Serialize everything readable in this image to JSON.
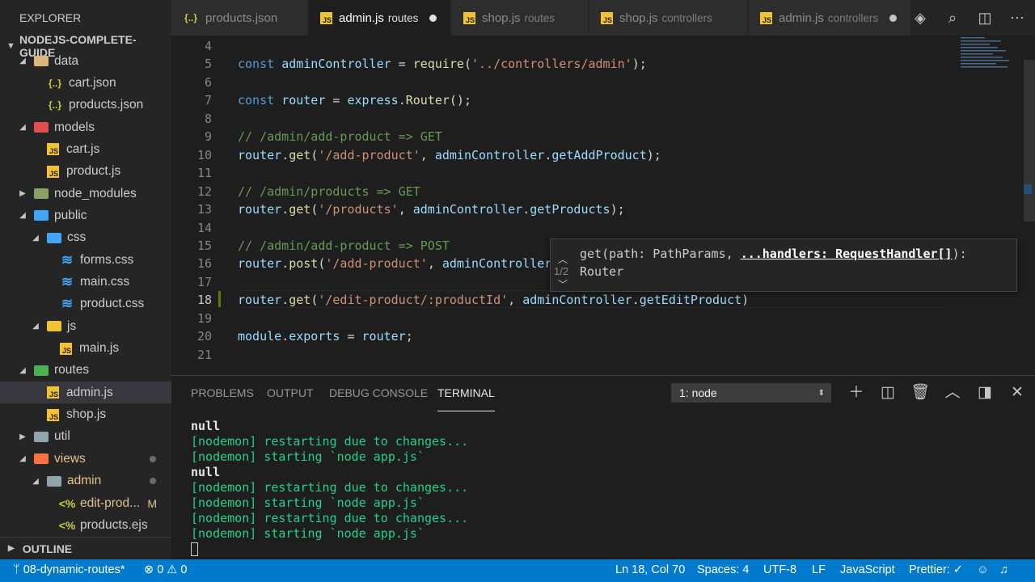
{
  "explorer": {
    "title": "EXPLORER",
    "folder": "NODEJS-COMPLETE-GUIDE",
    "tree": [
      {
        "label": "data",
        "type": "folder",
        "color": "#dcb67a",
        "open": true,
        "indent": 0
      },
      {
        "label": "cart.json",
        "type": "json",
        "indent": 1
      },
      {
        "label": "products.json",
        "type": "json",
        "indent": 1
      },
      {
        "label": "models",
        "type": "folder",
        "color": "#e04e4e",
        "open": true,
        "indent": 0
      },
      {
        "label": "cart.js",
        "type": "js",
        "indent": 1
      },
      {
        "label": "product.js",
        "type": "js",
        "indent": 1
      },
      {
        "label": "node_modules",
        "type": "folder",
        "color": "#8aa06a",
        "open": false,
        "indent": 0
      },
      {
        "label": "public",
        "type": "folder",
        "color": "#42a5f5",
        "open": true,
        "indent": 0
      },
      {
        "label": "css",
        "type": "folder",
        "color": "#42a5f5",
        "open": true,
        "indent": 1
      },
      {
        "label": "forms.css",
        "type": "css",
        "indent": 2
      },
      {
        "label": "main.css",
        "type": "css",
        "indent": 2
      },
      {
        "label": "product.css",
        "type": "css",
        "indent": 2
      },
      {
        "label": "js",
        "type": "folder",
        "color": "#f1c232",
        "open": true,
        "indent": 1
      },
      {
        "label": "main.js",
        "type": "js",
        "indent": 2
      },
      {
        "label": "routes",
        "type": "folder",
        "color": "#4caf50",
        "open": true,
        "indent": 0
      },
      {
        "label": "admin.js",
        "type": "js",
        "indent": 1,
        "selected": true
      },
      {
        "label": "shop.js",
        "type": "js",
        "indent": 1
      },
      {
        "label": "util",
        "type": "folder",
        "color": "#90a4ae",
        "open": false,
        "indent": 0
      },
      {
        "label": "views",
        "type": "folder",
        "color": "#ff7043",
        "open": true,
        "indent": 0,
        "label_color": "#e2c08d",
        "dot": true
      },
      {
        "label": "admin",
        "type": "folder",
        "color": "#90a4ae",
        "open": true,
        "indent": 1,
        "label_color": "#e2c08d",
        "dot": true
      },
      {
        "label": "edit-prod...",
        "type": "ejs",
        "indent": 2,
        "label_color": "#e2c08d",
        "mark": "M"
      },
      {
        "label": "products.ejs",
        "type": "ejs",
        "indent": 2
      }
    ],
    "outline": "OUTLINE"
  },
  "tabs": [
    {
      "name": "products.json",
      "icon": "{..}",
      "desc": "",
      "active": false,
      "dirty": false
    },
    {
      "name": "admin.js",
      "icon": "JS",
      "desc": "routes",
      "active": true,
      "dirty": true
    },
    {
      "name": "shop.js",
      "icon": "JS",
      "desc": "routes",
      "active": false,
      "dirty": false
    },
    {
      "name": "shop.js",
      "icon": "JS",
      "desc": "controllers",
      "active": false,
      "dirty": false
    },
    {
      "name": "admin.js",
      "icon": "JS",
      "desc": "controllers",
      "active": false,
      "dirty": true
    }
  ],
  "editor": {
    "current_line": 18,
    "lines": [
      {
        "n": 4,
        "tokens": []
      },
      {
        "n": 5,
        "tokens": [
          [
            "kw",
            "const"
          ],
          [
            "t",
            " "
          ],
          [
            "var",
            "adminController"
          ],
          [
            "t",
            " = "
          ],
          [
            "fn",
            "require"
          ],
          [
            "t",
            "("
          ],
          [
            "str",
            "'../controllers/admin'"
          ],
          [
            "t",
            ");"
          ]
        ]
      },
      {
        "n": 6,
        "tokens": []
      },
      {
        "n": 7,
        "tokens": [
          [
            "kw",
            "const"
          ],
          [
            "t",
            " "
          ],
          [
            "var",
            "router"
          ],
          [
            "t",
            " = "
          ],
          [
            "var",
            "express"
          ],
          [
            "t",
            "."
          ],
          [
            "fn",
            "Router"
          ],
          [
            "t",
            "();"
          ]
        ]
      },
      {
        "n": 8,
        "tokens": []
      },
      {
        "n": 9,
        "tokens": [
          [
            "cm",
            "// /admin/add-product => GET"
          ]
        ]
      },
      {
        "n": 10,
        "tokens": [
          [
            "var",
            "router"
          ],
          [
            "t",
            "."
          ],
          [
            "fn",
            "get"
          ],
          [
            "t",
            "("
          ],
          [
            "str",
            "'/add-product'"
          ],
          [
            "t",
            ", "
          ],
          [
            "var",
            "adminController"
          ],
          [
            "t",
            "."
          ],
          [
            "var",
            "getAddProduct"
          ],
          [
            "t",
            ");"
          ]
        ]
      },
      {
        "n": 11,
        "tokens": []
      },
      {
        "n": 12,
        "tokens": [
          [
            "cm",
            "// /admin/products => GET"
          ]
        ]
      },
      {
        "n": 13,
        "tokens": [
          [
            "var",
            "router"
          ],
          [
            "t",
            "."
          ],
          [
            "fn",
            "get"
          ],
          [
            "t",
            "("
          ],
          [
            "str",
            "'/products'"
          ],
          [
            "t",
            ", "
          ],
          [
            "var",
            "adminController"
          ],
          [
            "t",
            "."
          ],
          [
            "var",
            "getProducts"
          ],
          [
            "t",
            ");"
          ]
        ]
      },
      {
        "n": 14,
        "tokens": []
      },
      {
        "n": 15,
        "tokens": [
          [
            "cm",
            "// /admin/add-product => POST"
          ]
        ]
      },
      {
        "n": 16,
        "tokens": [
          [
            "var",
            "router"
          ],
          [
            "t",
            "."
          ],
          [
            "fn",
            "post"
          ],
          [
            "t",
            "("
          ],
          [
            "str",
            "'/add-product'"
          ],
          [
            "t",
            ", "
          ],
          [
            "var",
            "adminController"
          ]
        ]
      },
      {
        "n": 17,
        "tokens": []
      },
      {
        "n": 18,
        "tokens": [
          [
            "var",
            "router"
          ],
          [
            "t",
            "."
          ],
          [
            "fn",
            "get"
          ],
          [
            "t",
            "("
          ],
          [
            "str",
            "'/edit-product/:productId'"
          ],
          [
            "t",
            ", "
          ],
          [
            "var",
            "adminController"
          ],
          [
            "t",
            "."
          ],
          [
            "var",
            "getEditProduct"
          ],
          [
            "t",
            ")"
          ]
        ]
      },
      {
        "n": 19,
        "tokens": []
      },
      {
        "n": 20,
        "tokens": [
          [
            "var",
            "module"
          ],
          [
            "t",
            "."
          ],
          [
            "var",
            "exports"
          ],
          [
            "t",
            " = "
          ],
          [
            "var",
            "router"
          ],
          [
            "t",
            ";"
          ]
        ]
      },
      {
        "n": 21,
        "tokens": []
      }
    ],
    "hover": {
      "counter": "1/2",
      "sig_pre": "get(path: PathParams, ",
      "sig_param": "...handlers: RequestHandler[]",
      "sig_post": "):",
      "sig_line2": "Router"
    }
  },
  "panel": {
    "tabs": [
      "PROBLEMS",
      "OUTPUT",
      "DEBUG CONSOLE",
      "TERMINAL"
    ],
    "active_tab": "TERMINAL",
    "terminal_select": "1: node",
    "lines": [
      {
        "c": "w",
        "text": "null"
      },
      {
        "c": "g",
        "text": "[nodemon] restarting due to changes..."
      },
      {
        "c": "g",
        "text": "[nodemon] starting `node app.js`"
      },
      {
        "c": "w",
        "text": "null"
      },
      {
        "c": "g",
        "text": "[nodemon] restarting due to changes..."
      },
      {
        "c": "g",
        "text": "[nodemon] starting `node app.js`"
      },
      {
        "c": "g",
        "text": "[nodemon] restarting due to changes..."
      },
      {
        "c": "g",
        "text": "[nodemon] starting `node app.js`"
      }
    ]
  },
  "status": {
    "branch": "08-dynamic-routes*",
    "errors": "0",
    "warnings": "0",
    "position": "Ln 18, Col 70",
    "spaces": "Spaces: 4",
    "encoding": "UTF-8",
    "eol": "LF",
    "language": "JavaScript",
    "prettier": "Prettier: ✓"
  },
  "colors": {
    "accent": "#007acc",
    "git_modified": "#e2c08d",
    "terminal_green": "#23d18b"
  }
}
